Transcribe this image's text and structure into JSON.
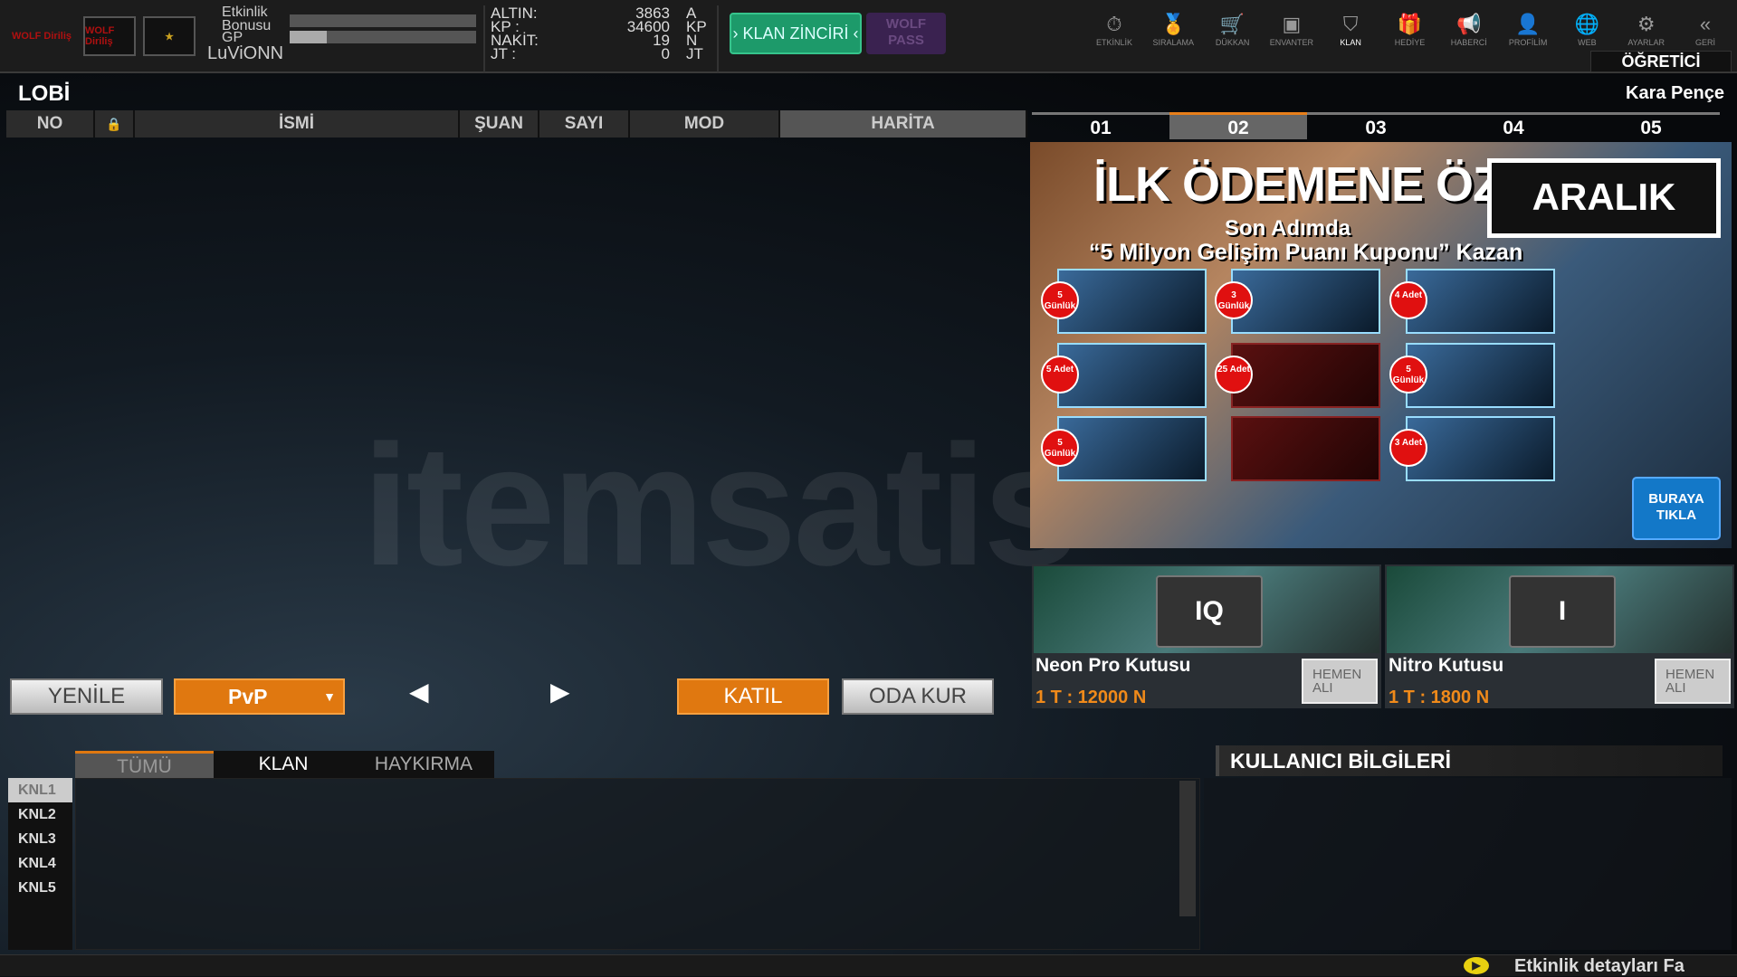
{
  "header": {
    "logos": [
      "WOLF Diriliş",
      "WOLF Diriliş",
      "rank-emblem"
    ],
    "event_bonus_label": "Etkinlik Bonusu",
    "gp_label": "GP",
    "gp_progress": 0.2,
    "event_bonus_progress": 0,
    "username": "LuViONN",
    "currencies": [
      {
        "label": "ALTIN:",
        "value": "3863",
        "unit": "A"
      },
      {
        "label": "KP :",
        "value": "34600",
        "unit": "KP"
      },
      {
        "label": "NAKİT:",
        "value": "19",
        "unit": "N"
      },
      {
        "label": "JT :",
        "value": "0",
        "unit": "JT"
      }
    ],
    "klan_zinciri": "› KLAN ZİNCİRİ ‹",
    "wolf_pass": "WOLF PASS",
    "nav": [
      {
        "label": "ETKİNLİK",
        "icon": "stopwatch-icon"
      },
      {
        "label": "SIRALAMA",
        "icon": "medal-icon"
      },
      {
        "label": "DÜKKAN",
        "icon": "cart-icon"
      },
      {
        "label": "ENVANTER",
        "icon": "chest-icon"
      },
      {
        "label": "KLAN",
        "icon": "shield-icon"
      },
      {
        "label": "HEDİYE",
        "icon": "gift-icon"
      },
      {
        "label": "HABERCİ",
        "icon": "megaphone-icon"
      },
      {
        "label": "PROFİLİM",
        "icon": "profile-icon"
      },
      {
        "label": "WEB",
        "icon": "globe-icon"
      },
      {
        "label": "AYARLAR",
        "icon": "gear-icon"
      },
      {
        "label": "GERİ",
        "icon": "back-icon"
      }
    ],
    "ogretici": "ÖĞRETİCİ"
  },
  "lobby": {
    "title": "LOBİ",
    "columns": [
      "NO",
      "🔒",
      "İSMİ",
      "ŞUAN",
      "SAYI",
      "MOD",
      "HARİTA"
    ],
    "buttons": {
      "refresh": "YENİLE",
      "mode": "PvP",
      "prev": "◀",
      "next": "▶",
      "join": "KATIL",
      "create": "ODA KUR"
    }
  },
  "right": {
    "server_name": "Kara Pençe",
    "tabs": [
      "01",
      "02",
      "03",
      "04",
      "05"
    ],
    "selected_tab": 1,
    "banner": {
      "title": "İLK ÖDEMENE ÖZEL",
      "month": "ARALIK",
      "line1": "Son Adımda",
      "line2": "“5 Milyon Gelişim Puanı Kuponu” Kazan",
      "badges": [
        "5 Günlük",
        "3 Günlük",
        "4 Adet",
        "5 Adet",
        "25 Adet",
        "5 Günlük",
        "5 Günlük",
        "3 Adet"
      ],
      "cta": "BURAYA TIKLA"
    },
    "boxes": [
      {
        "name": "Neon Pro Kutusu",
        "price": "1 T : 12000 N",
        "buy": "HEMEN ALI",
        "crate": "IQ"
      },
      {
        "name": "Nitro Kutusu",
        "price": "1 T : 1800 N",
        "buy": "HEMEN ALI",
        "crate": "I"
      }
    ]
  },
  "chat": {
    "tabs": [
      "TÜMÜ",
      "KLAN",
      "HAYKIRMA"
    ],
    "channels": [
      "KNL1",
      "KNL2",
      "KNL3",
      "KNL4",
      "KNL5"
    ]
  },
  "user_info": {
    "title": "KULLANICI BİLGİLERİ"
  },
  "status": {
    "text": "Etkinlik detayları Fa"
  },
  "watermark": "itemsatis"
}
